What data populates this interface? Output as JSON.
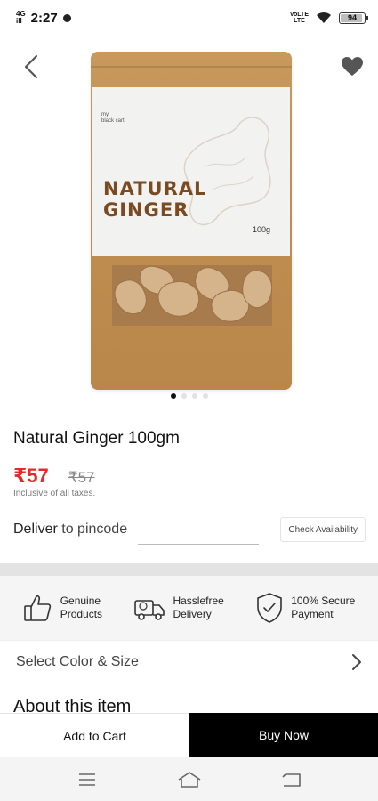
{
  "status_bar": {
    "network": "4G",
    "signal_sub": "ill",
    "time": "2:27",
    "volte": "VoLTE",
    "lte": "LTE",
    "battery_level": 94,
    "battery_text": "94"
  },
  "product_image": {
    "pack_title": "NATURAL\nGINGER",
    "pack_weight": "100g",
    "brand_lines": "my\nblack cart",
    "slide_count": 4,
    "active_slide": 1
  },
  "product": {
    "title": "Natural Ginger 100gm",
    "price": "₹57",
    "mrp": "₹57",
    "tax_note": "Inclusive of all taxes."
  },
  "delivery": {
    "label": "Deliver",
    "label_sub": "to pincode",
    "pincode_value": "",
    "check_button": "Check Availability"
  },
  "features": [
    {
      "icon": "thumbs-up-icon",
      "text": "Genuine\nProducts"
    },
    {
      "icon": "delivery-truck-icon",
      "text": "Hasslefree\nDelivery"
    },
    {
      "icon": "shield-check-icon",
      "text": "100% Secure\nPayment"
    }
  ],
  "options": {
    "select_label": "Select Color & Size"
  },
  "about": {
    "heading": "About this item"
  },
  "actions": {
    "add_to_cart": "Add to Cart",
    "buy_now": "Buy Now"
  },
  "colors": {
    "price_red": "#e42b26",
    "buy_button": "#000000",
    "pouch": "#c8995c"
  }
}
